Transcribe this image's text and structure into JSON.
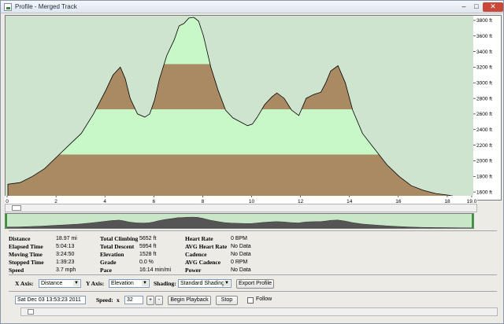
{
  "window": {
    "title": "Profile - Merged Track",
    "close": "✕",
    "minimize": "–",
    "maximize": "□"
  },
  "chart_data": {
    "type": "area",
    "xlabel": "",
    "ylabel": "",
    "xlim": [
      0,
      19
    ],
    "ylim": [
      1480,
      3860
    ],
    "x_ticks": [
      "0",
      "2",
      "4",
      "6",
      "8",
      "10",
      "12",
      "14",
      "16",
      "18",
      "19.0"
    ],
    "y_ticks": [
      "1600 ft",
      "1800 ft",
      "2000 ft",
      "2200 ft",
      "2400 ft",
      "2600 ft",
      "2800 ft",
      "3000 ft",
      "3200 ft",
      "3400 ft",
      "3600 ft",
      "3800 ft"
    ],
    "shading_bands": [
      {
        "from": 1480,
        "to": 2080,
        "color": "#a98a62"
      },
      {
        "from": 2080,
        "to": 2660,
        "color": "#c8f7c8"
      },
      {
        "from": 2660,
        "to": 3240,
        "color": "#a98a62"
      },
      {
        "from": 3240,
        "to": 3860,
        "color": "#c8f7c8"
      }
    ],
    "background_color": "#cfe4cf",
    "series": [
      {
        "x": [
          0,
          0.5,
          1,
          1.5,
          2,
          2.5,
          3,
          3.5,
          4,
          4.3,
          4.6,
          4.8,
          5.0,
          5.3,
          5.6,
          5.8,
          6.0,
          6.2,
          6.5,
          6.8,
          7.0,
          7.2,
          7.4,
          7.6,
          7.8,
          8.0,
          8.3,
          8.6,
          8.9,
          9.2,
          9.5,
          9.8,
          10.0,
          10.2,
          10.5,
          10.8,
          11.0,
          11.3,
          11.6,
          11.9,
          12.2,
          12.5,
          12.8,
          13.0,
          13.2,
          13.5,
          13.8,
          14.1,
          14.5,
          15.0,
          15.5,
          16.0,
          16.5,
          17.0,
          17.5,
          18.0,
          18.5,
          19.0
        ],
        "y": [
          1700,
          1720,
          1800,
          1900,
          2050,
          2200,
          2350,
          2600,
          2900,
          3100,
          3200,
          3050,
          2800,
          2600,
          2560,
          2600,
          2780,
          3050,
          3350,
          3550,
          3730,
          3760,
          3830,
          3840,
          3790,
          3600,
          3200,
          2900,
          2650,
          2550,
          2500,
          2450,
          2470,
          2560,
          2720,
          2820,
          2870,
          2800,
          2650,
          2580,
          2800,
          2850,
          2880,
          3000,
          3150,
          3220,
          3000,
          2650,
          2350,
          2150,
          1950,
          1800,
          1680,
          1620,
          1580,
          1560,
          1530,
          1510
        ]
      }
    ]
  },
  "overview": {
    "marker_label": ""
  },
  "stats": {
    "col1": [
      {
        "label": "Distance",
        "value": "18.97 mi"
      },
      {
        "label": "Elapsed Time",
        "value": "5:04:13"
      },
      {
        "label": "Moving Time",
        "value": "3:24:50"
      },
      {
        "label": "Stopped Time",
        "value": "1:39:23"
      },
      {
        "label": "Speed",
        "value": "3.7 mph"
      }
    ],
    "col2": [
      {
        "label": "Total Climbing",
        "value": "5652 ft"
      },
      {
        "label": "Total Descent",
        "value": "5954 ft"
      },
      {
        "label": "Elevation",
        "value": "1528 ft"
      },
      {
        "label": "Grade",
        "value": "0.0 %"
      },
      {
        "label": "Pace",
        "value": "16:14 min/mi"
      }
    ],
    "col3": [
      {
        "label": "Heart Rate",
        "value": "0 BPM"
      },
      {
        "label": "AVG Heart Rate",
        "value": "No Data"
      },
      {
        "label": "Cadence",
        "value": "No Data"
      },
      {
        "label": "AVG Cadence",
        "value": "0 RPM"
      },
      {
        "label": "Power",
        "value": "No Data"
      }
    ]
  },
  "controls": {
    "x_axis_label": "X Axis:",
    "x_axis_value": "Distance",
    "y_axis_label": "Y Axis:",
    "y_axis_value": "Elevation",
    "shading_label": "Shading:",
    "shading_value": "Standard Shading",
    "export_button": "Export Profile",
    "timestamp": "Sat Dec 03 13:53:23 2011",
    "speed_label": "Speed:",
    "speed_x": "x",
    "speed_value": "32",
    "plus": "+",
    "minus": "-",
    "begin_playback": "Begin Playback",
    "stop": "Stop",
    "follow_label": "Follow",
    "follow_checked": false
  }
}
